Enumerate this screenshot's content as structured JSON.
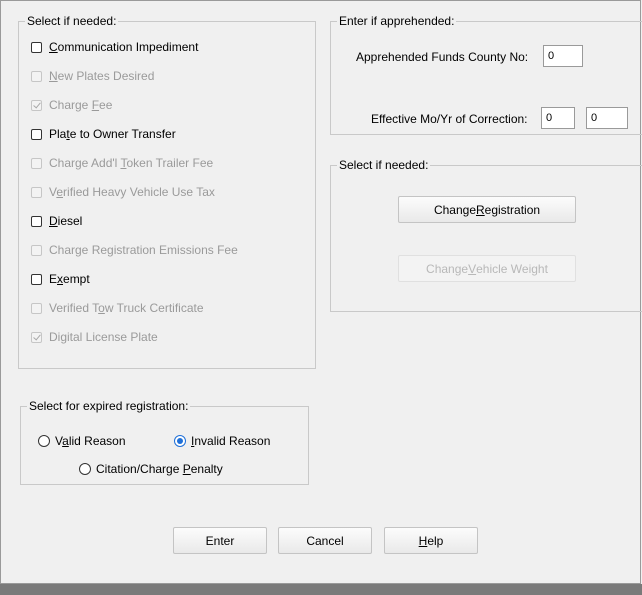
{
  "left_group": {
    "legend": "Select if needed:",
    "items": [
      {
        "pre": "",
        "mn": "C",
        "post": "ommunication Impediment",
        "enabled": true,
        "checked": false
      },
      {
        "pre": "",
        "mn": "N",
        "post": "ew Plates Desired",
        "enabled": false,
        "checked": false
      },
      {
        "pre": "Charge ",
        "mn": "F",
        "post": "ee",
        "enabled": false,
        "checked": true
      },
      {
        "pre": "Pla",
        "mn": "t",
        "post": "e to Owner Transfer",
        "enabled": true,
        "checked": false
      },
      {
        "pre": "Charge Add'l ",
        "mn": "T",
        "post": "oken Trailer Fee",
        "enabled": false,
        "checked": false
      },
      {
        "pre": "V",
        "mn": "e",
        "post": "rified Heavy Vehicle Use Tax",
        "enabled": false,
        "checked": false
      },
      {
        "pre": "",
        "mn": "D",
        "post": "iesel",
        "enabled": true,
        "checked": false
      },
      {
        "pre": "Charge Registration Emissions Fee",
        "mn": "",
        "post": "",
        "enabled": false,
        "checked": false
      },
      {
        "pre": "E",
        "mn": "x",
        "post": "empt",
        "enabled": true,
        "checked": false
      },
      {
        "pre": "Verified T",
        "mn": "o",
        "post": "w Truck Certificate",
        "enabled": false,
        "checked": false
      },
      {
        "pre": "Digital License Plate",
        "mn": "",
        "post": "",
        "enabled": false,
        "checked": true
      }
    ]
  },
  "apprehended": {
    "legend": "Enter if apprehended:",
    "county_label": "Apprehended Funds County No:",
    "county_value": "0",
    "moyr_label": "Effective Mo/Yr of Correction:",
    "month_value": "0",
    "year_value": "0"
  },
  "right_group": {
    "legend": "Select if needed:",
    "change_registration": {
      "pre": "Change ",
      "mn": "R",
      "post": "egistration"
    },
    "change_vehicle_weight": {
      "pre": "Change ",
      "mn": "V",
      "post": "ehicle Weight"
    }
  },
  "expired": {
    "legend": "Select for expired registration:",
    "valid": {
      "pre": "V",
      "mn": "a",
      "post": "lid Reason"
    },
    "invalid": {
      "pre": "",
      "mn": "I",
      "post": "nvalid Reason"
    },
    "citation": {
      "pre": "Citation/Charge ",
      "mn": "P",
      "post": "enalty"
    }
  },
  "buttons": {
    "enter": "Enter",
    "cancel": "Cancel",
    "help": {
      "pre": "",
      "mn": "H",
      "post": "elp"
    }
  }
}
